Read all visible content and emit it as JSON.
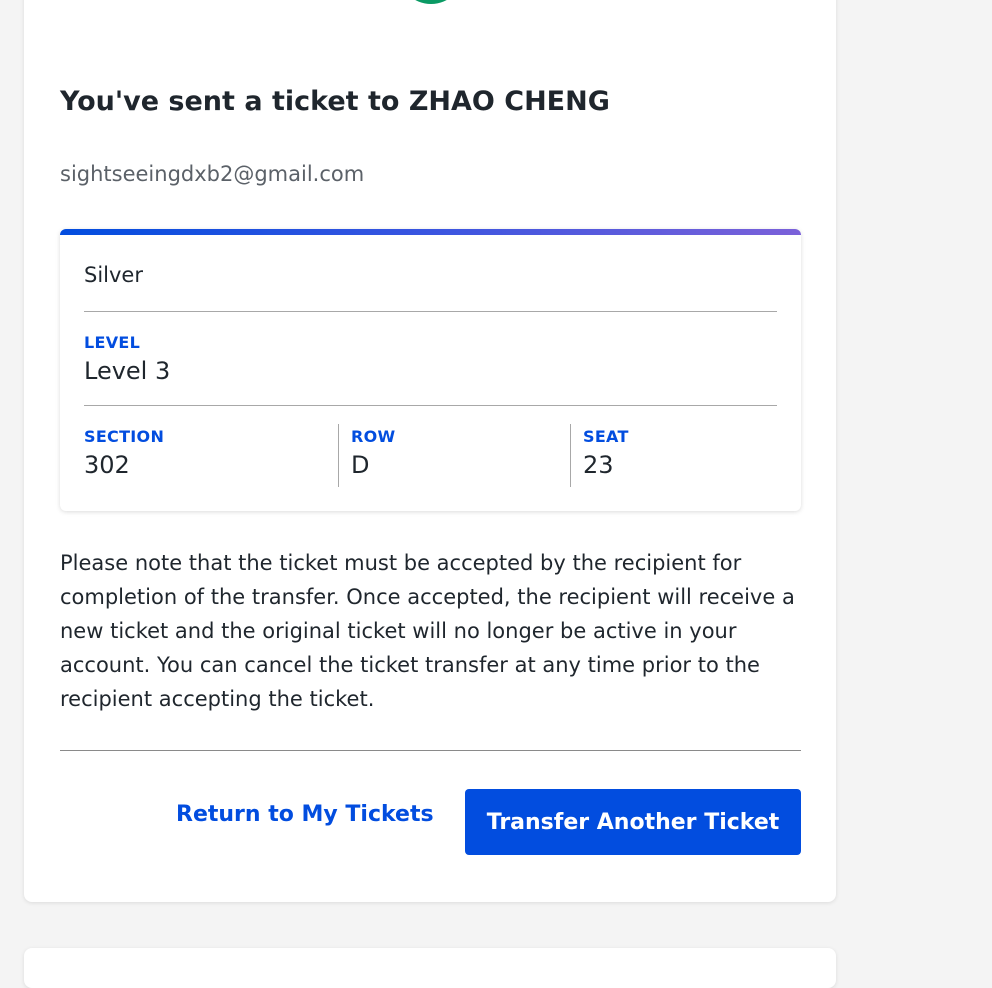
{
  "colors": {
    "accent": "#024ddf",
    "success": "#0b9a64",
    "text": "#1f262d",
    "muted": "#5b6168"
  },
  "confirmation": {
    "icon": "checkmark-icon",
    "title": "You've sent a ticket to ZHAO CHENG",
    "email": "sightseeingdxb2@gmail.com"
  },
  "ticket": {
    "type": "Silver",
    "level_label": "LEVEL",
    "level_value": "Level 3",
    "section_label": "SECTION",
    "section_value": "302",
    "row_label": "ROW",
    "row_value": "D",
    "seat_label": "SEAT",
    "seat_value": "23"
  },
  "note": "Please note that the ticket must be accepted by the recipient for completion of the transfer. Once accepted, the recipient will receive a new ticket and the original ticket will no longer be active in your account. You can cancel the ticket transfer at any time prior to the recipient accepting the ticket.",
  "actions": {
    "return_label": "Return to My Tickets",
    "transfer_label": "Transfer Another Ticket"
  }
}
